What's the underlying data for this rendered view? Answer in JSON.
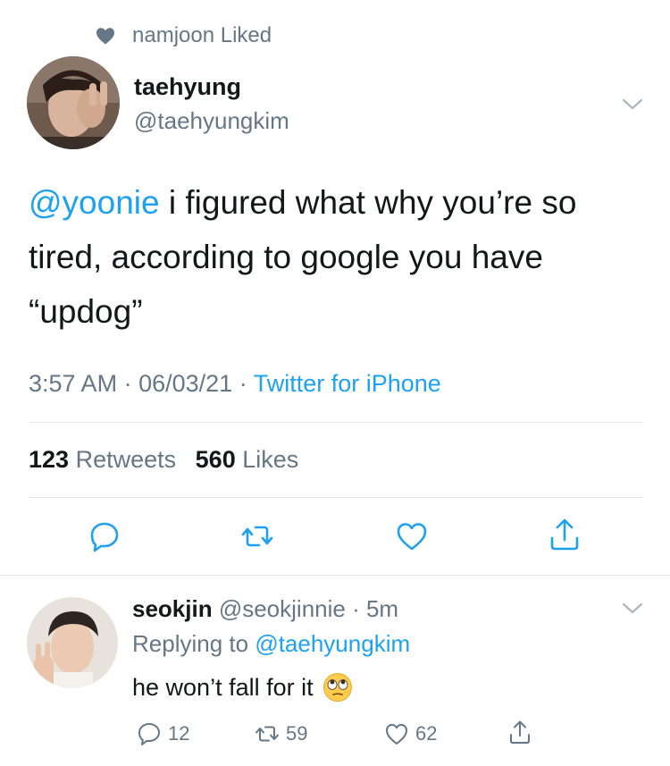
{
  "social_context": {
    "text": "namjoon Liked",
    "icon": "heart-icon"
  },
  "main_tweet": {
    "display_name": "taehyung",
    "handle": "@taehyungkim",
    "mention": "@yoonie",
    "text_rest": " i figured what why you’re so tired, according to google you have “updog”",
    "time": "3:57 AM",
    "date": "06/03/21",
    "source": "Twitter for iPhone",
    "retweet_count": "123",
    "retweet_label": "Retweets",
    "like_count": "560",
    "like_label": "Likes",
    "actions": [
      "reply-icon",
      "retweet-icon",
      "like-icon",
      "share-icon"
    ]
  },
  "reply_tweet": {
    "display_name": "seokjin",
    "handle": "@seokjinnie",
    "age": "5m",
    "replying_prefix": "Replying to",
    "replying_to": "@taehyungkim",
    "text": "he won’t fall for it",
    "emoji": "face-with-rolling-eyes",
    "reply_count": "12",
    "retweet_count": "59",
    "like_count": "62"
  },
  "colors": {
    "accent": "#1da1f2",
    "secondary_text": "#657786",
    "primary_text": "#14171a",
    "divider": "#e1e8ed"
  }
}
